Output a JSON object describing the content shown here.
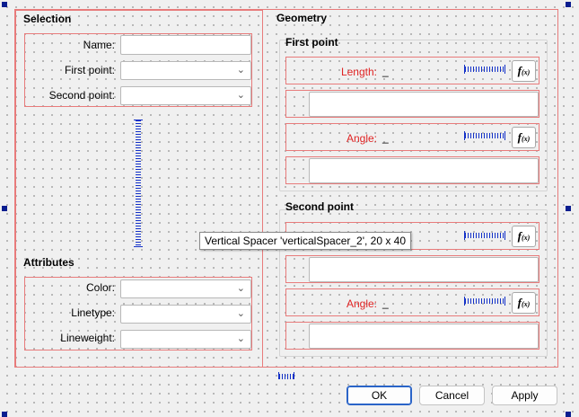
{
  "selection": {
    "title": "Selection",
    "name_label": "Name:",
    "name_value": "",
    "first_point_label": "First point:",
    "second_point_label": "Second point:"
  },
  "attributes": {
    "title": "Attributes",
    "color_label": "Color:",
    "linetype_label": "Linetype:",
    "lineweight_label": "Lineweight:"
  },
  "geometry": {
    "title": "Geometry",
    "first_point": {
      "title": "First point",
      "length_label": "Length:",
      "length_value": "_",
      "angle_label": "Angle:",
      "angle_value": "_"
    },
    "second_point": {
      "title": "Second point",
      "angle_label": "Angle:",
      "angle_value": "_"
    },
    "fx_main": "f",
    "fx_sub": "(x)"
  },
  "tooltip": "Vertical Spacer 'verticalSpacer_2', 20 x 40",
  "buttons": {
    "ok": "OK",
    "cancel": "Cancel",
    "apply": "Apply"
  },
  "colors": {
    "layout_border": "#e87b7b",
    "error_label": "#e02424",
    "selection_handle": "#0a1d8f",
    "spacer": "#1230c8"
  }
}
